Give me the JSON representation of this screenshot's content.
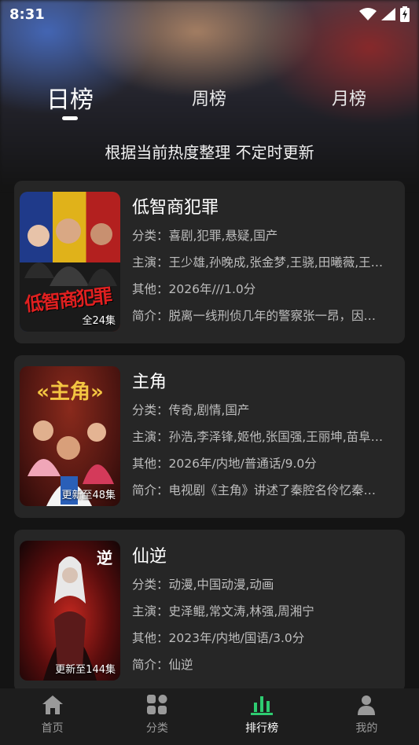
{
  "status_bar": {
    "time": "8:31"
  },
  "tabs": [
    {
      "label": "日榜",
      "active": true
    },
    {
      "label": "周榜",
      "active": false
    },
    {
      "label": "月榜",
      "active": false
    }
  ],
  "subtitle": "根据当前热度整理 不定时更新",
  "items": [
    {
      "title": "低智商犯罪",
      "badge": "全24集",
      "category": "分类：喜剧,犯罪,悬疑,国产",
      "cast": "主演：王少雄,孙晚成,张金梦,王骁,田曦薇,王…",
      "other": "其他：2026年///1.0分",
      "intro": "简介：脱离一线刑侦几年的警察张一昂，因…",
      "poster_text": "低智商犯罪"
    },
    {
      "title": "主角",
      "badge": "更新至48集",
      "category": "分类：传奇,剧情,国产",
      "cast": "主演：孙浩,李泽锋,姬他,张国强,王丽坤,苗阜…",
      "other": "其他：2026年/内地/普通话/9.0分",
      "intro": "简介：电视剧《主角》讲述了秦腔名伶忆秦…",
      "poster_text": "«主角»"
    },
    {
      "title": "仙逆",
      "badge": "更新至144集",
      "category": "分类：动漫,中国动漫,动画",
      "cast": "主演：史泽鲲,常文涛,林强,周湘宁",
      "other": "其他：2023年/内地/国语/3.0分",
      "intro": "简介：仙逆",
      "poster_text": "逆"
    }
  ],
  "nav": [
    {
      "label": "首页",
      "icon": "home-icon"
    },
    {
      "label": "分类",
      "icon": "category-icon"
    },
    {
      "label": "排行榜",
      "icon": "ranking-icon",
      "active": true
    },
    {
      "label": "我的",
      "icon": "profile-icon"
    }
  ],
  "colors": {
    "accent": "#2ecc71",
    "card": "#262626",
    "background": "#141414"
  }
}
